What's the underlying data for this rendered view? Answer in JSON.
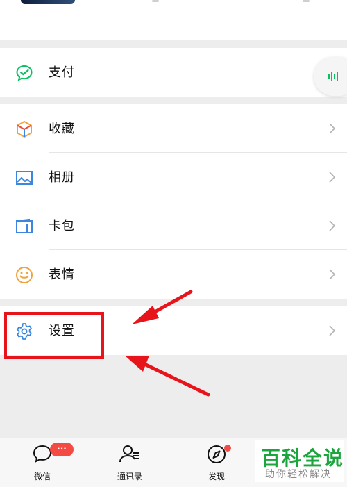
{
  "menu": {
    "pay": {
      "label": "支付",
      "icon": "wechat-pay-icon"
    },
    "favorites": {
      "label": "收藏",
      "icon": "cube-icon"
    },
    "album": {
      "label": "相册",
      "icon": "image-icon"
    },
    "cards": {
      "label": "卡包",
      "icon": "card-icon"
    },
    "stickers": {
      "label": "表情",
      "icon": "smiley-icon"
    },
    "settings": {
      "label": "设置",
      "icon": "gear-icon"
    }
  },
  "tabbar": {
    "chats": {
      "label": "微信",
      "badge": "···"
    },
    "contacts": {
      "label": "通讯录"
    },
    "discover": {
      "label": "发现"
    }
  },
  "watermark": {
    "title": "百科全说",
    "subtitle": "助你轻松解决"
  },
  "colors": {
    "accent_green": "#07c160",
    "highlight_red": "#e8141b",
    "badge_red": "#f44a44"
  }
}
